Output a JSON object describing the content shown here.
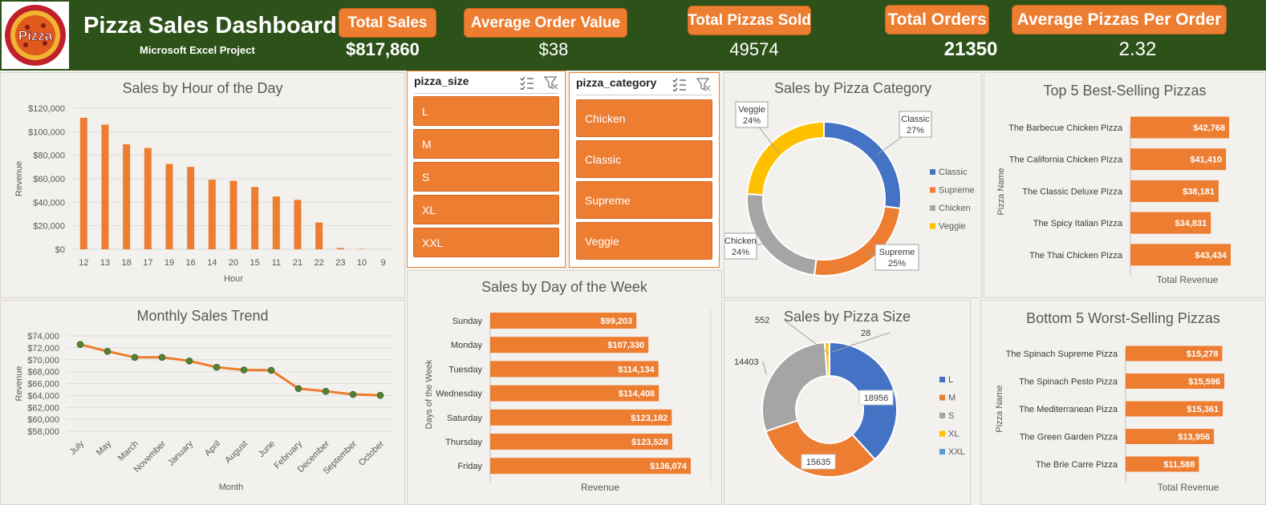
{
  "header": {
    "title": "Pizza Sales Dashboard",
    "subtitle": "Microsoft Excel Project",
    "logo_text": "Pizza"
  },
  "kpis": [
    {
      "label": "Total Sales",
      "value": "$817,860"
    },
    {
      "label": "Average Order Value",
      "value": "$38"
    },
    {
      "label": "Total Pizzas Sold",
      "value": "49574"
    },
    {
      "label": "Total Orders",
      "value": "21350"
    },
    {
      "label": "Average Pizzas Per Order",
      "value": "2.32"
    }
  ],
  "slicers": {
    "size": {
      "title": "pizza_size",
      "items": [
        "L",
        "M",
        "S",
        "XL",
        "XXL"
      ]
    },
    "category": {
      "title": "pizza_category",
      "items": [
        "Chicken",
        "Classic",
        "Supreme",
        "Veggie"
      ]
    }
  },
  "colors": {
    "accent": "#ed7d31",
    "header": "#2d5219",
    "blue": "#4472c4",
    "gray": "#a5a5a5",
    "gold": "#ffc000",
    "lightblue": "#5b9bd5",
    "green_dot": "#548235"
  },
  "chart_data": [
    {
      "id": "hour",
      "type": "bar",
      "title": "Sales by Hour of the Day",
      "xlabel": "Hour",
      "ylabel": "Revenue",
      "categories": [
        "12",
        "13",
        "18",
        "17",
        "19",
        "16",
        "14",
        "20",
        "15",
        "11",
        "21",
        "22",
        "23",
        "10",
        "9"
      ],
      "values": [
        111878,
        106066,
        89297,
        86238,
        72628,
        70055,
        59201,
        58216,
        52992,
        44936,
        42030,
        22815,
        1121,
        304,
        83
      ],
      "ylim": [
        0,
        120000
      ],
      "yticks": [
        "$0",
        "$20,000",
        "$40,000",
        "$60,000",
        "$80,000",
        "$100,000",
        "$120,000"
      ]
    },
    {
      "id": "month",
      "type": "line",
      "title": "Monthly Sales Trend",
      "xlabel": "Month",
      "ylabel": "Revenue",
      "categories": [
        "July",
        "May",
        "March",
        "November",
        "January",
        "April",
        "August",
        "June",
        "February",
        "December",
        "September",
        "October"
      ],
      "values": [
        72558,
        71403,
        70397,
        70395,
        69793,
        68737,
        68278,
        68230,
        65160,
        64701,
        64180,
        64028
      ],
      "ylim": [
        58000,
        74000
      ],
      "yticks": [
        "$58,000",
        "$60,000",
        "$62,000",
        "$64,000",
        "$66,000",
        "$68,000",
        "$70,000",
        "$72,000",
        "$74,000"
      ]
    },
    {
      "id": "day",
      "type": "bar",
      "orientation": "horizontal",
      "title": "Sales by Day of the Week",
      "xlabel": "Revenue",
      "ylabel": "Days of the Week",
      "categories": [
        "Sunday",
        "Monday",
        "Tuesday",
        "Wednesday",
        "Saturday",
        "Thursday",
        "Friday"
      ],
      "values": [
        99203,
        107330,
        114134,
        114408,
        123182,
        123528,
        136074
      ],
      "labels": [
        "$99,203",
        "$107,330",
        "$114,134",
        "$114,408",
        "$123,182",
        "$123,528",
        "$136,074"
      ]
    },
    {
      "id": "category",
      "type": "pie",
      "title": "Sales by Pizza Category",
      "categories": [
        "Classic",
        "Supreme",
        "Chicken",
        "Veggie"
      ],
      "values": [
        27,
        25,
        24,
        24
      ],
      "labels": [
        [
          "Classic",
          "27%"
        ],
        [
          "Supreme",
          "25%"
        ],
        [
          "Chicken",
          "24%"
        ],
        [
          "Veggie",
          "24%"
        ]
      ],
      "legend": "right"
    },
    {
      "id": "top5",
      "type": "bar",
      "orientation": "horizontal",
      "title": "Top 5 Best-Selling Pizzas",
      "xlabel": "Total Revenue",
      "ylabel": "Pizza Name",
      "categories": [
        "The Barbecue Chicken Pizza",
        "The California Chicken Pizza",
        "The Classic Deluxe Pizza",
        "The Spicy Italian Pizza",
        "The Thai Chicken Pizza"
      ],
      "values": [
        42768,
        41410,
        38181,
        34831,
        43434
      ],
      "labels": [
        "$42,768",
        "$41,410",
        "$38,181",
        "$34,831",
        "$43,434"
      ]
    },
    {
      "id": "size",
      "type": "pie",
      "title": "Sales by Pizza Size",
      "categories": [
        "L",
        "M",
        "S",
        "XL",
        "XXL"
      ],
      "values": [
        18956,
        15635,
        14403,
        552,
        28
      ],
      "labels": [
        "18956",
        "15635",
        "14403",
        "552",
        "28"
      ],
      "legend": "right"
    },
    {
      "id": "bottom5",
      "type": "bar",
      "orientation": "horizontal",
      "title": "Bottom 5 Worst-Selling Pizzas",
      "xlabel": "Total Revenue",
      "ylabel": "Pizza Name",
      "categories": [
        "The Spinach Supreme Pizza",
        "The Spinach Pesto Pizza",
        "The Mediterranean Pizza",
        "The Green Garden Pizza",
        "The Brie Carre Pizza"
      ],
      "values": [
        15278,
        15596,
        15361,
        13956,
        11588
      ],
      "labels": [
        "$15,278",
        "$15,596",
        "$15,361",
        "$13,956",
        "$11,588"
      ]
    }
  ]
}
